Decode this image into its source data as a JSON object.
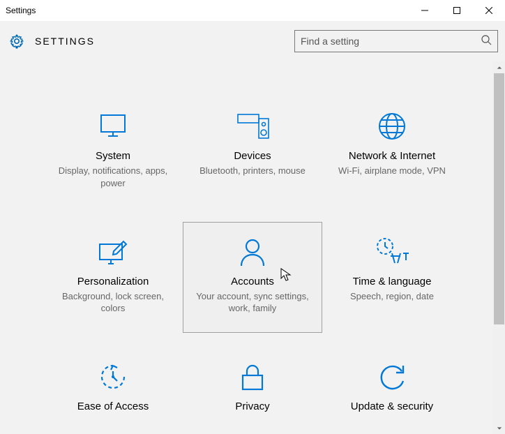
{
  "window": {
    "title": "Settings"
  },
  "header": {
    "title": "SETTINGS",
    "search_placeholder": "Find a setting"
  },
  "tiles": [
    {
      "title": "System",
      "sub": "Display, notifications, apps, power"
    },
    {
      "title": "Devices",
      "sub": "Bluetooth, printers, mouse"
    },
    {
      "title": "Network & Internet",
      "sub": "Wi-Fi, airplane mode, VPN"
    },
    {
      "title": "Personalization",
      "sub": "Background, lock screen, colors"
    },
    {
      "title": "Accounts",
      "sub": "Your account, sync settings, work, family"
    },
    {
      "title": "Time & language",
      "sub": "Speech, region, date"
    },
    {
      "title": "Ease of Access",
      "sub": ""
    },
    {
      "title": "Privacy",
      "sub": ""
    },
    {
      "title": "Update & security",
      "sub": ""
    }
  ]
}
